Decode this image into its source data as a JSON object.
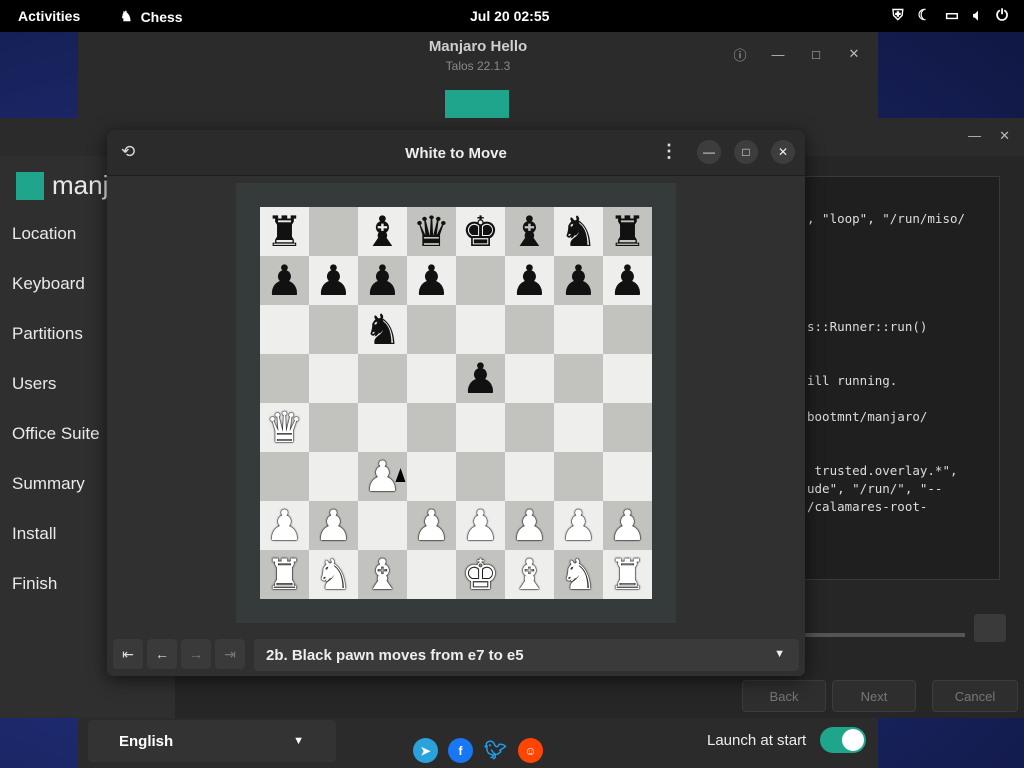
{
  "topbar": {
    "activities": "Activities",
    "app_name": "Chess",
    "clock": "Jul 20  02:55"
  },
  "hello": {
    "title": "Manjaro Hello",
    "subtitle": "Talos 22.1.3",
    "language": "English",
    "launch_label": "Launch at start",
    "launch_enabled": true,
    "social": [
      "telegram",
      "facebook",
      "twitter",
      "reddit"
    ]
  },
  "installer": {
    "logo_text": "manja",
    "sidebar": [
      "Location",
      "Keyboard",
      "Partitions",
      "Users",
      "Office Suite",
      "Summary",
      "Install",
      "Finish"
    ],
    "log_lines": [
      ", \"loop\", \"/run/miso/",
      "s::Runner::run()",
      "ill running.",
      "bootmnt/manjaro/",
      " trusted.overlay.*\",",
      "ude\", \"/run/\", \"--",
      "/calamares-root-"
    ],
    "buttons": {
      "back": "Back",
      "next": "Next",
      "cancel": "Cancel"
    }
  },
  "chess": {
    "title": "White to Move",
    "move_selection": "2b. Black pawn moves from e7 to e5",
    "board": [
      [
        "br",
        "",
        "bb",
        "bq",
        "bk",
        "bb",
        "bn",
        "br"
      ],
      [
        "bp",
        "bp",
        "bp",
        "bp",
        "",
        "bp",
        "bp",
        "bp"
      ],
      [
        "",
        "",
        "bn",
        "",
        "",
        "",
        "",
        ""
      ],
      [
        "",
        "",
        "",
        "",
        "bp",
        "",
        "",
        ""
      ],
      [
        "wq",
        "",
        "",
        "",
        "",
        "",
        "",
        ""
      ],
      [
        "",
        "",
        "wp",
        "",
        "",
        "",
        "",
        ""
      ],
      [
        "wp",
        "wp",
        "",
        "wp",
        "wp",
        "wp",
        "wp",
        "wp"
      ],
      [
        "wr",
        "wn",
        "wb",
        "",
        "wk",
        "wb",
        "wn",
        "wr"
      ]
    ]
  }
}
